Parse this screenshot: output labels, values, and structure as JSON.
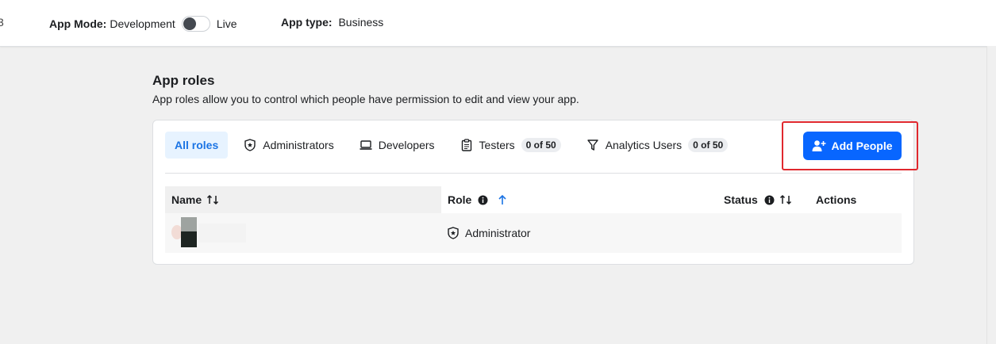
{
  "topbar": {
    "cut_text": "3",
    "app_mode_label": "App Mode:",
    "mode_development": "Development",
    "mode_live": "Live",
    "app_type_label": "App type:",
    "app_type_value": "Business"
  },
  "section": {
    "title": "App roles",
    "subtitle": "App roles allow you to control which people have permission to edit and view your app."
  },
  "tabs": [
    {
      "label": "All roles",
      "icon": "none",
      "active": true
    },
    {
      "label": "Administrators",
      "icon": "shield-icon"
    },
    {
      "label": "Developers",
      "icon": "laptop-icon"
    },
    {
      "label": "Testers",
      "icon": "clipboard-icon",
      "badge": "0 of 50"
    },
    {
      "label": "Analytics Users",
      "icon": "filter-icon",
      "badge": "0 of 50"
    }
  ],
  "add_button": {
    "label": "Add People",
    "icon": "add-person-icon"
  },
  "table": {
    "headers": {
      "name": "Name",
      "role": "Role",
      "status": "Status",
      "actions": "Actions"
    },
    "rows": [
      {
        "name": "",
        "role": "Administrator",
        "status": "",
        "actions": ""
      }
    ]
  },
  "colors": {
    "primary": "#0866ff",
    "tab_active_bg": "#e7f3ff",
    "tab_active_text": "#1b74e4",
    "highlight": "#e0282e",
    "page_bg": "#f0f0f0"
  }
}
